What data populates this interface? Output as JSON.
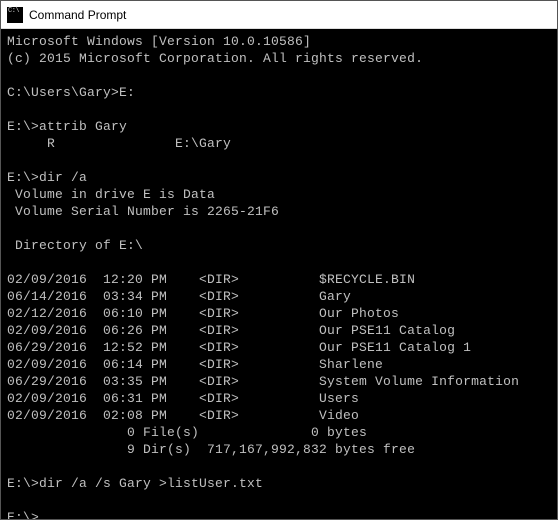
{
  "window": {
    "title": "Command Prompt"
  },
  "terminal": {
    "header_line1": "Microsoft Windows [Version 10.0.10586]",
    "header_line2": "(c) 2015 Microsoft Corporation. All rights reserved.",
    "prompt1": "C:\\Users\\Gary>E:",
    "prompt2": "E:\\>attrib Gary",
    "attrib_out": "     R               E:\\Gary",
    "prompt3": "E:\\>dir /a",
    "vol_line": " Volume in drive E is Data",
    "serial_line": " Volume Serial Number is 2265-21F6",
    "dirof_line": " Directory of E:\\",
    "entries": [
      "02/09/2016  12:20 PM    <DIR>          $RECYCLE.BIN",
      "06/14/2016  03:34 PM    <DIR>          Gary",
      "02/12/2016  06:10 PM    <DIR>          Our Photos",
      "02/09/2016  06:26 PM    <DIR>          Our PSE11 Catalog",
      "06/29/2016  12:52 PM    <DIR>          Our PSE11 Catalog 1",
      "02/09/2016  06:14 PM    <DIR>          Sharlene",
      "06/29/2016  03:35 PM    <DIR>          System Volume Information",
      "02/09/2016  06:31 PM    <DIR>          Users",
      "02/09/2016  02:08 PM    <DIR>          Video"
    ],
    "summary1": "               0 File(s)              0 bytes",
    "summary2": "               9 Dir(s)  717,167,992,832 bytes free",
    "prompt4": "E:\\>dir /a /s Gary >listUser.txt",
    "prompt5": "E:\\>"
  }
}
